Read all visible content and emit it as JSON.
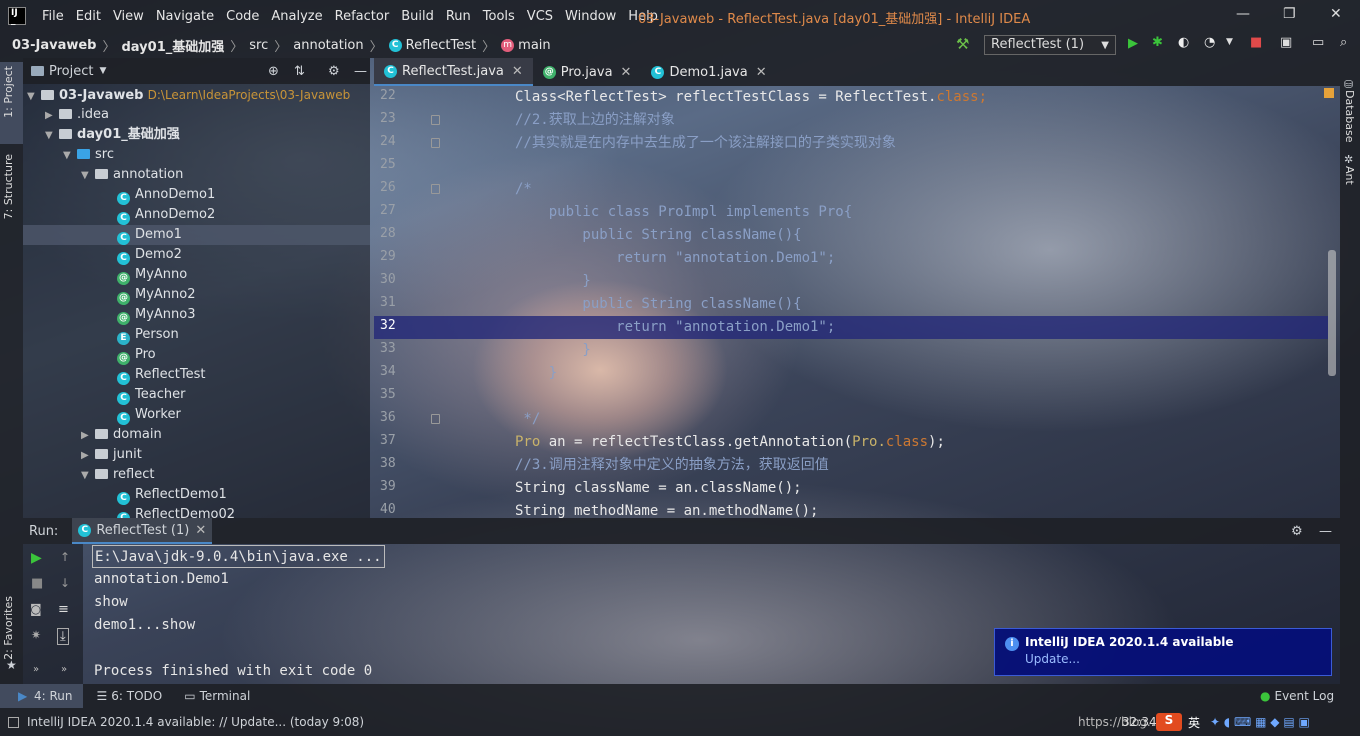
{
  "titlebar": {
    "menu": [
      "File",
      "Edit",
      "View",
      "Navigate",
      "Code",
      "Analyze",
      "Refactor",
      "Build",
      "Run",
      "Tools",
      "VCS",
      "Window",
      "Help"
    ],
    "title": "03-Javaweb - ReflectTest.java [day01_基础加强] - IntelliJ IDEA"
  },
  "navbar": {
    "crumbs": [
      "03-Javaweb",
      "day01_基础加强",
      "src",
      "annotation",
      "ReflectTest",
      "main"
    ],
    "run_config": "ReflectTest (1)"
  },
  "left_tabs": {
    "project": "1: Project",
    "structure": "7: Structure",
    "favorites": "2: Favorites"
  },
  "right_tabs": {
    "database": "Database",
    "ant": "Ant"
  },
  "project": {
    "header": "Project",
    "root": {
      "name": "03-Javaweb",
      "path": "D:\\Learn\\IdeaProjects\\03-Javaweb"
    },
    "tree": [
      {
        "label": ".idea"
      },
      {
        "label": "day01_基础加强"
      },
      {
        "label": "src"
      },
      {
        "label": "annotation"
      },
      {
        "label": "AnnoDemo1"
      },
      {
        "label": "AnnoDemo2"
      },
      {
        "label": "Demo1"
      },
      {
        "label": "Demo2"
      },
      {
        "label": "MyAnno"
      },
      {
        "label": "MyAnno2"
      },
      {
        "label": "MyAnno3"
      },
      {
        "label": "Person"
      },
      {
        "label": "Pro"
      },
      {
        "label": "ReflectTest"
      },
      {
        "label": "Teacher"
      },
      {
        "label": "Worker"
      },
      {
        "label": "domain"
      },
      {
        "label": "junit"
      },
      {
        "label": "reflect"
      },
      {
        "label": "ReflectDemo1"
      },
      {
        "label": "ReflectDemo02"
      }
    ]
  },
  "editor": {
    "tabs": [
      "ReflectTest.java",
      "Pro.java",
      "Demo1.java"
    ],
    "line_numbers": [
      "22",
      "23",
      "24",
      "25",
      "26",
      "27",
      "28",
      "29",
      "30",
      "31",
      "32",
      "33",
      "34",
      "35",
      "36",
      "37",
      "38",
      "39",
      "40"
    ],
    "code": {
      "l22a": "Class<ReflectTest> reflectTestClass = ReflectTest.",
      "l22b": "class",
      "l22c": ";",
      "l23": "//2.获取上边的注解对象",
      "l24": "//其实就是在内存中去生成了一个该注解接口的子类实现对象",
      "l26": "/*",
      "l27": "    public class ProImpl implements Pro{",
      "l28": "        public String className(){",
      "l29": "            return \"annotation.Demo1\";",
      "l30": "        }",
      "l31": "        public String className(){",
      "l32": "            return \"annotation.Demo1\";",
      "l33": "        }",
      "l34": "    }",
      "l36": " */",
      "l37a": "Pro",
      "l37b": " an = reflectTestClass.getAnnotation(",
      "l37c": "Pro.",
      "l37d": "class",
      "l37e": ");",
      "l38": "//3.调用注释对象中定义的抽象方法，获取返回值",
      "l39": "String className = an.className();",
      "l40": "String methodName = an.methodName();"
    }
  },
  "run": {
    "label": "Run:",
    "tab": "ReflectTest (1)",
    "output": [
      "E:\\Java\\jdk-9.0.4\\bin\\java.exe ...",
      "annotation.Demo1",
      "show",
      "demo1...show",
      "",
      "Process finished with exit code 0"
    ]
  },
  "bottom_tools": {
    "run": "4: Run",
    "todo": "6: TODO",
    "terminal": "Terminal",
    "event_log": "Event Log"
  },
  "status": {
    "message": "IntelliJ IDEA 2020.1.4 available: // Update... (today 9:08)",
    "position": "32:34",
    "url_fragment": "https://blog..."
  },
  "notification": {
    "title": "IntelliJ IDEA 2020.1.4 available",
    "link": "Update..."
  },
  "colors": {
    "keyword": "#cc7832",
    "string": "#b3d18c",
    "comment": "#8a9fc6",
    "selection": "#23287a"
  }
}
